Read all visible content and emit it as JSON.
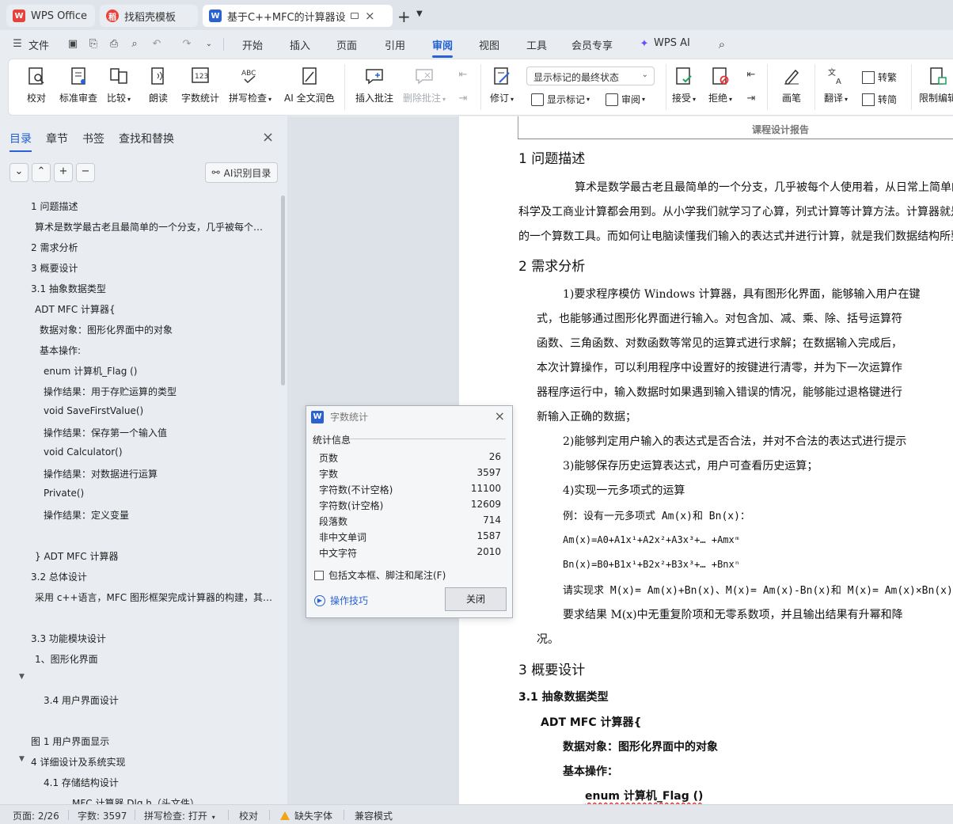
{
  "tabs": [
    {
      "label": "WPS Office",
      "icon": "wps-office-icon"
    },
    {
      "label": "找稻壳模板",
      "icon": "docer-icon"
    },
    {
      "label": "基于C++MFC的计算器设计",
      "icon": "word-doc-icon"
    }
  ],
  "menu": {
    "file": "文件",
    "items": [
      "开始",
      "插入",
      "页面",
      "引用",
      "审阅",
      "视图",
      "工具",
      "会员专享",
      "WPS AI"
    ],
    "active": "审阅"
  },
  "ribbon": {
    "proofread": "校对",
    "standard_review": "标准审查",
    "compare": "比较",
    "read_aloud": "朗读",
    "word_count": "字数统计",
    "spell_check": "拼写检查",
    "ai_polish": "AI 全文润色",
    "insert_comment": "插入批注",
    "delete_comment": "删除批注",
    "track_changes": "修订",
    "markup_state": "显示标记的最终状态",
    "show_markup": "显示标记",
    "review_pane": "审阅",
    "accept": "接受",
    "reject": "拒绝",
    "ink": "画笔",
    "translate": "翻译",
    "to_traditional": "转繁",
    "to_simplified": "转简",
    "restrict_edit": "限制编辑"
  },
  "panel": {
    "tabs": [
      "目录",
      "章节",
      "书签",
      "查找和替换"
    ],
    "ai_toc": "AI识别目录",
    "toc": [
      "1  问题描述",
      "算术是数学最古老且最简单的一个分支，几乎被每个…",
      "2  需求分析",
      "3  概要设计",
      "3.1 抽象数据类型",
      "ADT MFC 计算器{",
      "数据对象：图形化界面中的对象",
      "基本操作:",
      "enum  计算机_Flag  ()",
      "操作结果：用于存贮运算的类型",
      "void SaveFirstValue()",
      "操作结果：保存第一个输入值",
      "void Calculator()",
      "操作结果：对数据进行运算",
      "Private()",
      "操作结果：定义变量",
      "} ADT MFC 计算器",
      "3.2  总体设计",
      "采用 c++语言，MFC 图形框架完成计算器的构建，其…",
      "3.3  功能模块设计",
      "1、图形化界面",
      "3.4  用户界面设计",
      "图 1  用户界面显示",
      "4  详细设计及系统实现",
      "4.1  存储结构设计",
      "MFC 计算器 Dlg.h（头文件）"
    ]
  },
  "document": {
    "header": "课程设计报告",
    "h1_problem": "1  问题描述",
    "p1": [
      "算术是数学最古老且最简单的一个分支，几乎被每个人使用着，从日常上简单的",
      "科学及工商业计算都会用到。从小学我们就学习了心算，列式计算等计算方法。计算器就是",
      "的一个算数工具。而如何让电脑读懂我们输入的表达式并进行计算，就是我们数据结构所要"
    ],
    "h1_req": "2  需求分析",
    "req": [
      "1)要求程序模仿 Windows 计算器，具有图形化界面，能够输入用户在键",
      "式，也能够通过图形化界面进行输入。对包含加、减、乘、除、括号运算符",
      "函数、三角函数、对数函数等常见的运算式进行求解；在数据输入完成后，",
      "本次计算操作，可以利用程序中设置好的按键进行清零，并为下一次运算作",
      "器程序运行中，输入数据时如果遇到输入错误的情况，能够能过退格键进行",
      "新输入正确的数据；",
      "2)能够判定用户输入的表达式是否合法，并对不合法的表达式进行提示",
      "3)能够保存历史运算表达式，用户可查看历史运算；",
      "4)实现一元多项式的运算",
      "例：设有一元多项式 Am(x)和 Bn(x)：",
      "Am(x)=A0+A1x¹+A2x²+A3x³+…  +Amxᵐ",
      "Bn(x)=B0+B1x¹+B2x²+B3x³+…  +Bnxⁿ",
      "请实现求 M(x)= Am(x)+Bn(x)、M(x)= Am(x)-Bn(x)和 M(x)= Am(x)×Bn(x)",
      "要求结果 M(x)中无重复阶项和无零系数项，并且输出结果有升幂和降",
      "况。"
    ],
    "h1_overview": "3  概要设计",
    "h2_adt": "3.1 抽象数据类型",
    "adt": [
      "ADT MFC 计算器{",
      "数据对象：图形化界面中的对象",
      "基本操作：",
      "enum 计算机_Flag ()"
    ]
  },
  "dialog": {
    "title": "字数统计",
    "section": "统计信息",
    "stats": [
      {
        "label": "页数",
        "value": "26"
      },
      {
        "label": "字数",
        "value": "3597"
      },
      {
        "label": "字符数(不计空格)",
        "value": "11100"
      },
      {
        "label": "字符数(计空格)",
        "value": "12609"
      },
      {
        "label": "段落数",
        "value": "714"
      },
      {
        "label": "非中文单词",
        "value": "1587"
      },
      {
        "label": "中文字符",
        "value": "2010"
      }
    ],
    "checkbox": "包括文本框、脚注和尾注(F)",
    "tips": "操作技巧",
    "close": "关闭"
  },
  "status": {
    "page": "页面: 2/26",
    "words": "字数: 3597",
    "spell": "拼写检查: 打开",
    "proof": "校对",
    "missing_font": "缺失字体",
    "compat": "兼容模式"
  },
  "colors": {
    "accent": "#2a62d6",
    "warning": "#f0a418",
    "wps_red": "#e8403a"
  }
}
